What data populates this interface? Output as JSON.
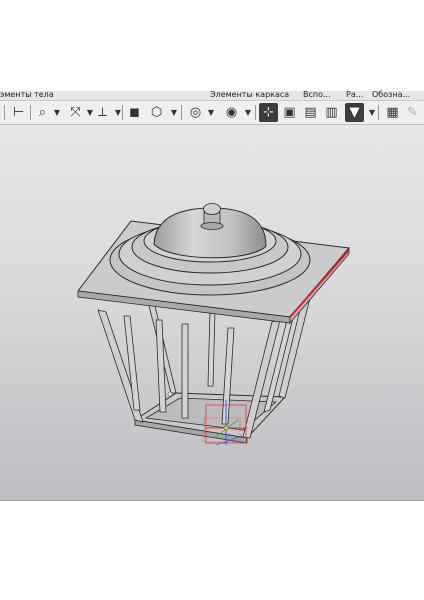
{
  "menubar": {
    "items": [
      "эменты тела",
      "Элементы каркаса",
      "Вспо...",
      "Ра...",
      "Обозна..."
    ]
  },
  "toolbar": {
    "buttons": [
      {
        "name": "sketch-icon",
        "glyph": "⊢"
      },
      {
        "name": "zoom-icon",
        "glyph": "🔍"
      },
      {
        "name": "pan-icon",
        "glyph": "✥"
      },
      {
        "name": "orient-icon",
        "glyph": "⟂"
      },
      {
        "name": "shaded-cube-icon",
        "glyph": "◼"
      },
      {
        "name": "wireframe-cube-icon",
        "glyph": "⬡"
      },
      {
        "name": "hide-icon",
        "glyph": "◎"
      },
      {
        "name": "display-mode-icon",
        "glyph": "◉"
      },
      {
        "name": "snap-icon",
        "glyph": "⊹"
      },
      {
        "name": "section-icon",
        "glyph": "▣"
      },
      {
        "name": "layers-icon",
        "glyph": "▤"
      },
      {
        "name": "view-icon",
        "glyph": "▥"
      },
      {
        "name": "filter-icon",
        "glyph": "▼"
      },
      {
        "name": "properties-icon",
        "glyph": "▦"
      },
      {
        "name": "edit-pen-icon",
        "glyph": "✎"
      }
    ]
  },
  "colors": {
    "model_body": "#c6c6c8",
    "model_edge": "#2b2b2b",
    "highlight_edge": "#d8202a",
    "axis_x": "#e23b3b",
    "axis_y": "#38b04a",
    "axis_z": "#3a5de0"
  }
}
